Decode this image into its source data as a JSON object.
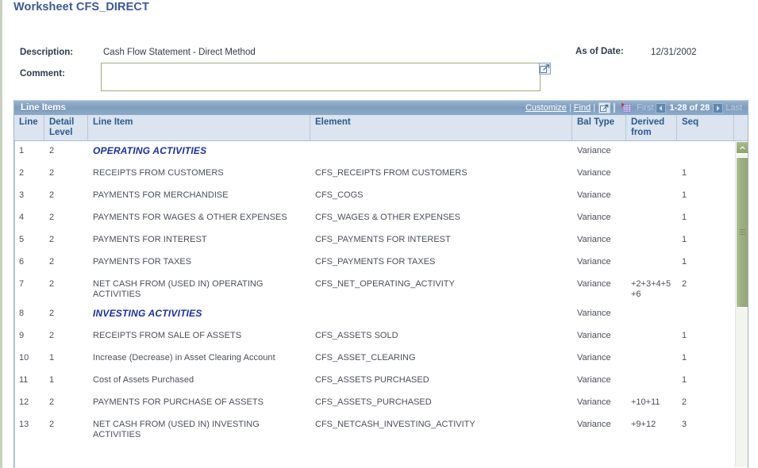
{
  "page": {
    "title": "Worksheet CFS_DIRECT"
  },
  "header": {
    "description_label": "Description:",
    "description_value": "Cash Flow Statement - Direct Method",
    "comment_label": "Comment:",
    "comment_value": "",
    "comment_placeholder": "",
    "asof_label": "As of Date:",
    "asof_value": "12/31/2002"
  },
  "grid": {
    "title": "Line Items",
    "customize_label": "Customize",
    "find_label": "Find",
    "separator": "|",
    "zoom_icon": "expand-zoom-icon",
    "download_icon": "download-to-excel-icon",
    "first_label": "First",
    "last_label": "Last",
    "counter": "1-28 of 28",
    "prev_icon": "left-triangle-icon",
    "next_icon": "right-triangle-icon",
    "columns": [
      "Line",
      "Detail Level",
      "Line Item",
      "Element",
      "Bal Type",
      "Derived from",
      "Seq"
    ],
    "column_lines": [
      [
        "Line"
      ],
      [
        "Detail",
        "Level"
      ],
      [
        "Line Item"
      ],
      [
        "Element"
      ],
      [
        "Bal Type"
      ],
      [
        "Derived",
        "from"
      ],
      [
        "Seq"
      ]
    ],
    "rows": [
      {
        "line": "1",
        "detail": "2",
        "item": "OPERATING ACTIVITIES",
        "element": "",
        "bal": "Variance",
        "derived": "",
        "seq": "",
        "section": true
      },
      {
        "line": "2",
        "detail": "2",
        "item": "RECEIPTS FROM CUSTOMERS",
        "element": "CFS_RECEIPTS FROM CUSTOMERS",
        "bal": "Variance",
        "derived": "",
        "seq": "1",
        "section": false
      },
      {
        "line": "3",
        "detail": "2",
        "item": "PAYMENTS FOR MERCHANDISE",
        "element": "CFS_COGS",
        "bal": "Variance",
        "derived": "",
        "seq": "1",
        "section": false
      },
      {
        "line": "4",
        "detail": "2",
        "item": "PAYMENTS FOR WAGES & OTHER EXPENSES",
        "element": "CFS_WAGES & OTHER EXPENSES",
        "bal": "Variance",
        "derived": "",
        "seq": "1",
        "section": false
      },
      {
        "line": "5",
        "detail": "2",
        "item": "PAYMENTS FOR INTEREST",
        "element": "CFS_PAYMENTS FOR INTEREST",
        "bal": "Variance",
        "derived": "",
        "seq": "1",
        "section": false
      },
      {
        "line": "6",
        "detail": "2",
        "item": "PAYMENTS FOR TAXES",
        "element": "CFS_PAYMENTS FOR TAXES",
        "bal": "Variance",
        "derived": "",
        "seq": "1",
        "section": false
      },
      {
        "line": "7",
        "detail": "2",
        "item": "NET CASH FROM (USED IN) OPERATING ACTIVITIES",
        "element": "CFS_NET_OPERATING_ACTIVITY",
        "bal": "Variance",
        "derived": "+2+3+4+5+6",
        "seq": "2",
        "section": false
      },
      {
        "line": "8",
        "detail": "2",
        "item": "INVESTING ACTIVITIES",
        "element": "",
        "bal": "Variance",
        "derived": "",
        "seq": "",
        "section": true
      },
      {
        "line": "9",
        "detail": "2",
        "item": "RECEIPTS FROM SALE OF ASSETS",
        "element": "CFS_ASSETS SOLD",
        "bal": "Variance",
        "derived": "",
        "seq": "1",
        "section": false
      },
      {
        "line": "10",
        "detail": "1",
        "item": "Increase (Decrease) in Asset Clearing Account",
        "element": "CFS_ASSET_CLEARING",
        "bal": "Variance",
        "derived": "",
        "seq": "1",
        "section": false
      },
      {
        "line": "11",
        "detail": "1",
        "item": "Cost of Assets Purchased",
        "element": "CFS_ASSETS PURCHASED",
        "bal": "Variance",
        "derived": "",
        "seq": "1",
        "section": false
      },
      {
        "line": "12",
        "detail": "2",
        "item": "PAYMENTS FOR PURCHASE OF ASSETS",
        "element": "CFS_ASSETS_PURCHASED",
        "bal": "Variance",
        "derived": "+10+11",
        "seq": "2",
        "section": false
      },
      {
        "line": "13",
        "detail": "2",
        "item": "NET CASH FROM (USED IN) INVESTING ACTIVITIES",
        "element": "CFS_NETCASH_INVESTING_ACTIVITY",
        "bal": "Variance",
        "derived": "+9+12",
        "seq": "3",
        "section": false
      }
    ]
  },
  "scrollbar": {
    "up_icon": "chevron-up-icon",
    "thumb": "scroll-thumb"
  },
  "colors": {
    "title_blue": "#3b5998",
    "grid_header_blue": "#7e9cbd",
    "column_header": "#dbe4ef",
    "section_text": "#1c2fa0",
    "scrollbar_green": "#9db082",
    "field_border_green": "#9cad7e"
  }
}
